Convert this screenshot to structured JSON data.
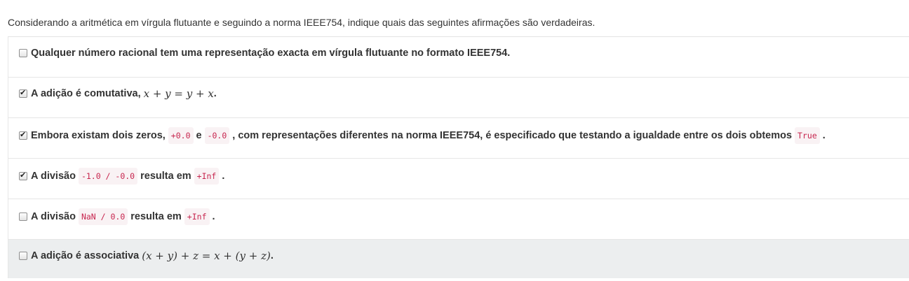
{
  "question": {
    "prompt": "Considerando a aritmética em vírgula flutuante e seguindo a norma IEEE754, indique quais das seguintes afirmações são verdadeiras."
  },
  "options": [
    {
      "checked": false,
      "text_1": "Qualquer número racional tem uma representação exacta em vírgula flutuante no formato IEEE754."
    },
    {
      "checked": true,
      "text_1": "A adição é comutativa,",
      "math": "x + y = y + x",
      "text_2": "."
    },
    {
      "checked": true,
      "text_1": "Embora existam dois zeros,",
      "code_1": "+0.0",
      "text_2": "e",
      "code_2": "-0.0",
      "text_3": ", com representações diferentes na norma IEEE754, é especificado que testando a igualdade entre os dois obtemos",
      "code_3": "True",
      "text_4": "."
    },
    {
      "checked": true,
      "text_1": "A divisão",
      "code_1": "-1.0 / -0.0",
      "text_2": "resulta em",
      "code_2": "+Inf",
      "text_3": "."
    },
    {
      "checked": false,
      "text_1": "A divisão",
      "code_1": "NaN / 0.0",
      "text_2": "resulta em",
      "code_2": "+Inf",
      "text_3": "."
    },
    {
      "checked": false,
      "text_1": "A adição é associativa",
      "math": "(x + y) + z = x + (y + z)",
      "text_2": "."
    }
  ],
  "colors": {
    "code_text": "#c7254e",
    "code_bg": "#f9f2f4",
    "hover_row_bg": "#eceeef"
  }
}
